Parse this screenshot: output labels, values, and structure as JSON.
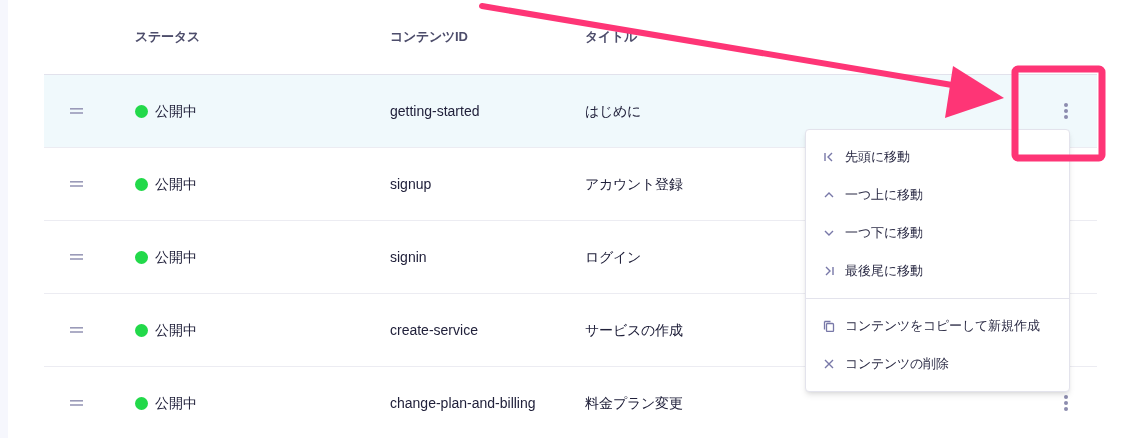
{
  "table": {
    "columns": [
      "ステータス",
      "コンテンツID",
      "タイトル"
    ],
    "rows": [
      {
        "status": "公開中",
        "color": "#22d94a",
        "id": "getting-started",
        "title": "はじめに",
        "selected": true
      },
      {
        "status": "公開中",
        "color": "#22d94a",
        "id": "signup",
        "title": "アカウント登録",
        "selected": false
      },
      {
        "status": "公開中",
        "color": "#22d94a",
        "id": "signin",
        "title": "ログイン",
        "selected": false
      },
      {
        "status": "公開中",
        "color": "#22d94a",
        "id": "create-service",
        "title": "サービスの作成",
        "selected": false
      },
      {
        "status": "公開中",
        "color": "#22d94a",
        "id": "change-plan-and-billing",
        "title": "料金プラン変更",
        "selected": false
      }
    ]
  },
  "context_menu": {
    "groups": [
      [
        {
          "kind": "first",
          "label": "先頭に移動"
        },
        {
          "kind": "up",
          "label": "一つ上に移動"
        },
        {
          "kind": "down",
          "label": "一つ下に移動"
        },
        {
          "kind": "last",
          "label": "最後尾に移動"
        }
      ],
      [
        {
          "kind": "copy",
          "label": "コンテンツをコピーして新規作成"
        },
        {
          "kind": "delete",
          "label": "コンテンツの削除"
        }
      ]
    ]
  },
  "annotations": {
    "arrow": true,
    "highlight_box": true
  }
}
